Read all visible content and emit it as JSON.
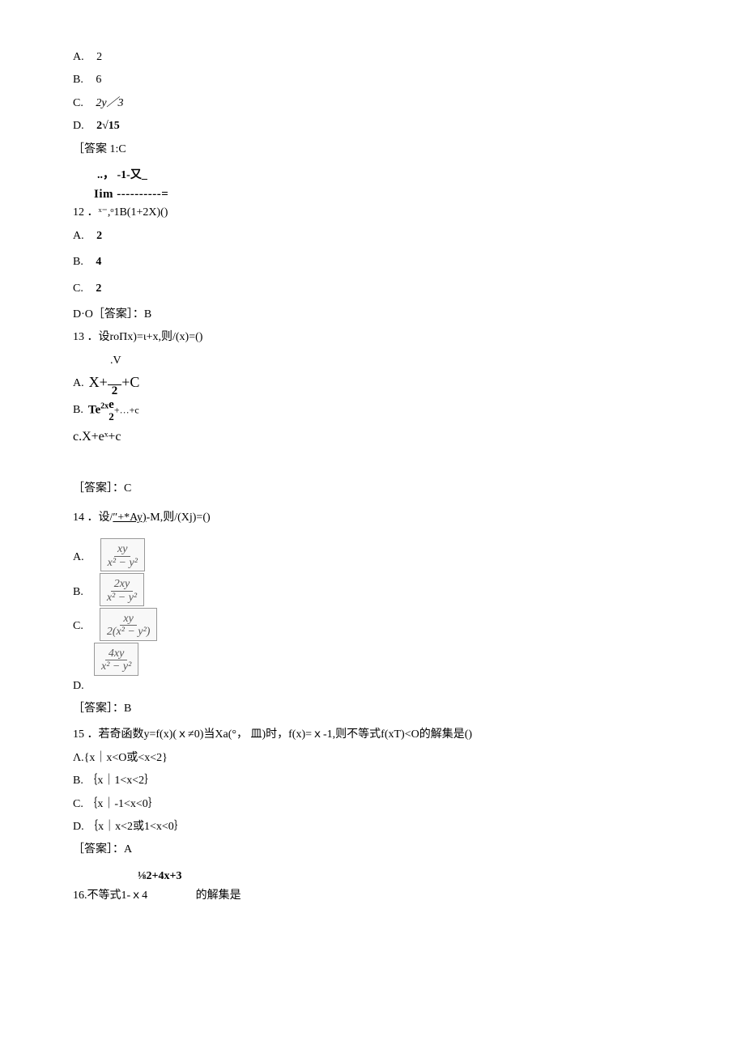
{
  "q11": {
    "options": {
      "A": "2",
      "B": "6",
      "C": "2y／3",
      "D": "2√15"
    },
    "answer": "［答案 1:C"
  },
  "q12": {
    "expr_top_1": "..，   -1-又_",
    "expr_top_2": "Iim ----------=",
    "stem": "12 ．ˣ⁻,ᵒ1B(1+2X)()",
    "options": {
      "A": "2",
      "B": "4",
      "C": "2"
    },
    "d_and_answer": "D·O［答案］：B"
  },
  "q13": {
    "stem": "13 ．设roΠx)=ι+x,则/(x)=()",
    "optA_dotV": ".V",
    "optA_main_left": "X+",
    "optA_frac_den": "2",
    "optA_main_right": "+C",
    "optB_left": "Te",
    "optB_sup": "2x",
    "optB_e": "e",
    "optB_under2": "2",
    "optB_right": "+…+c",
    "optC": "c.X+eˣ+c",
    "answer": "［答案］：C"
  },
  "q14": {
    "stem_pre": "14 ．设/",
    "stem_underline": "″+*Ay)",
    "stem_post": "-M,则/(Xj)=()",
    "A_num": "xy",
    "A_den": "x² − y²",
    "B_num": "2xy",
    "B_den": "x² − y²",
    "C_num": "xy",
    "C_den": "2(x² − y²)",
    "D_num": "4xy",
    "D_den": "x² − y²",
    "D_label": "D.",
    "answer": "［答案］：B"
  },
  "q15": {
    "stem": "15 ．若奇函数y=f(x)(ｘ≠0)当Xa(°， 皿)时，f(x)=ｘ-1,则不等式f(xT)<O的解集是()",
    "options": {
      "A": "Λ.{x｜x<O或<x<2}",
      "B": "B. ｛x｜1<x<2｝",
      "C": "C. ｛x｜-1<x<0｝",
      "D": "D. ｛x｜x<2或1<x<0｝"
    },
    "answer": "［答案］：A"
  },
  "q16": {
    "super": "⅛2+4x+3",
    "main_left": "16.不等式1-ｘ4",
    "main_right": "的解集是"
  }
}
